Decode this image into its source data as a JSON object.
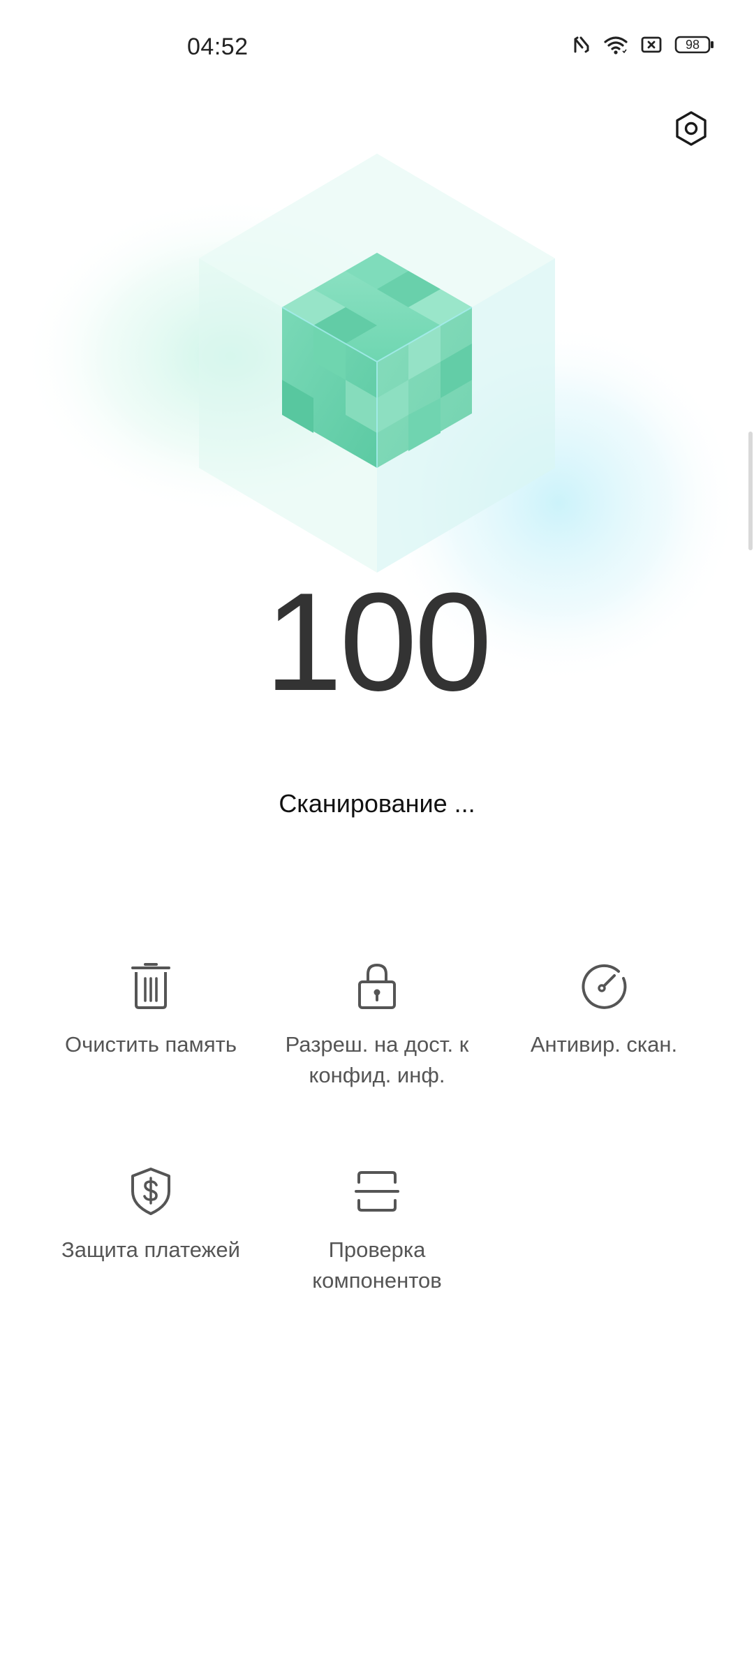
{
  "status_bar": {
    "time": "04:52",
    "battery": "98",
    "icons": [
      "nfc-icon",
      "wifi-icon",
      "sim-off-icon",
      "battery-icon"
    ]
  },
  "header": {
    "settings_icon": "settings-hexagon-icon"
  },
  "score": {
    "value": "100",
    "status": "Сканирование ..."
  },
  "features": [
    {
      "label": "Очистить память",
      "icon": "trash-icon"
    },
    {
      "label": "Разреш. на дост. к конфид. инф.",
      "icon": "lock-icon"
    },
    {
      "label": "Антивир. скан.",
      "icon": "gauge-icon"
    },
    {
      "label": "Защита платежей",
      "icon": "shield-dollar-icon"
    },
    {
      "label": "Проверка компонентов",
      "icon": "scan-frame-icon"
    }
  ],
  "colors": {
    "accent_green": "#5fcfa5",
    "accent_cyan": "#bff1f6",
    "text_primary": "#333333",
    "text_secondary": "#555555"
  }
}
